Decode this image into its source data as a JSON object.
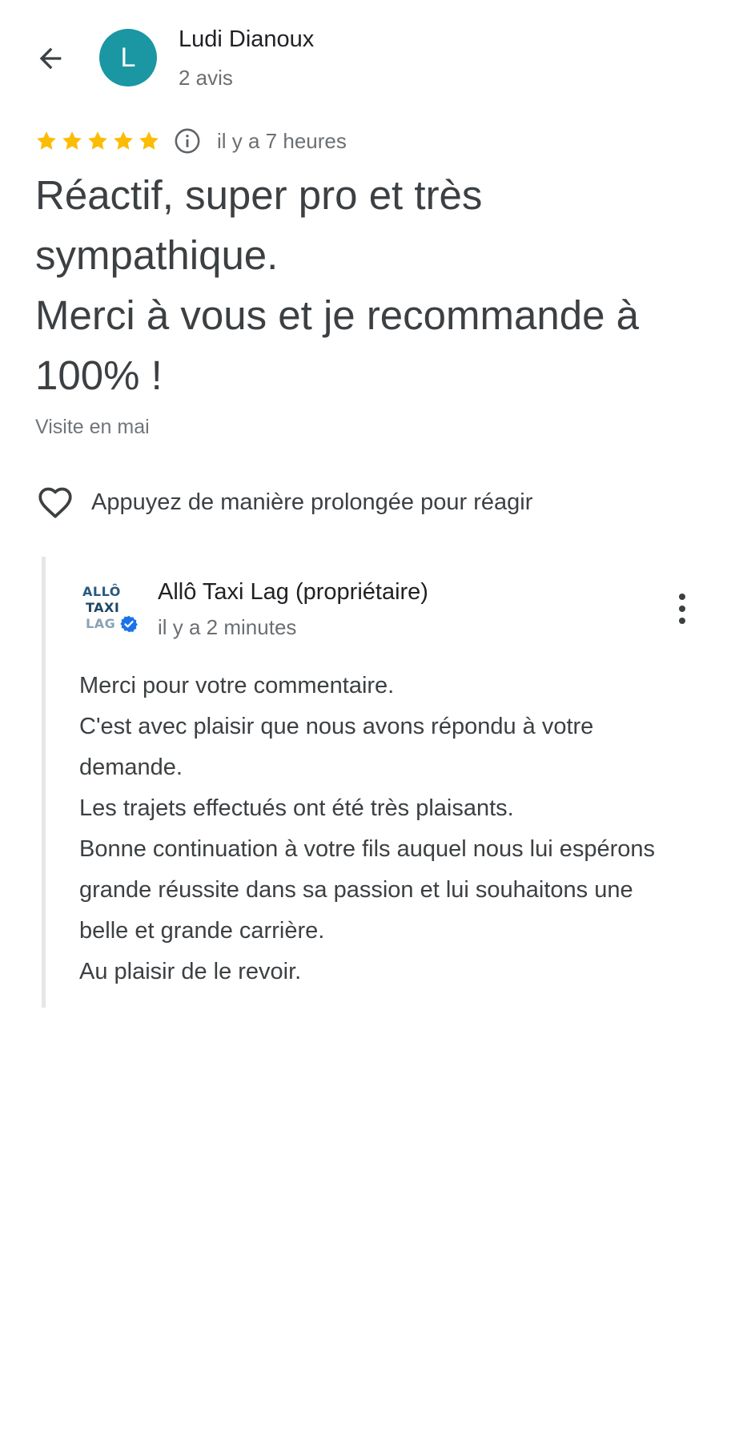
{
  "header": {
    "avatar_letter": "L",
    "avatar_color": "#1a97a3",
    "user_name": "Ludi Dianoux",
    "user_reviews": "2 avis"
  },
  "review": {
    "rating": 5,
    "rating_max": 5,
    "star_color": "#fbbc04",
    "time": "il y a 7 heures",
    "text": "Réactif, super pro et très sympathique.\nMerci à vous et je recommande à 100% !",
    "visit": "Visite en mai"
  },
  "reaction": {
    "label": "Appuyez de manière prolongée pour réagir"
  },
  "owner_reply": {
    "logo_text": [
      "ALLÔ",
      "TAXI",
      "LAG"
    ],
    "name": "Allô Taxi Lag (propriétaire)",
    "time": "il y a 2 minutes",
    "text": "Merci pour votre commentaire.\nC'est avec plaisir que nous avons répondu à votre demande.\nLes trajets effectués ont été très plaisants.\nBonne continuation à votre fils auquel nous lui espérons grande réussite dans sa passion et lui souhaitons une belle et grande carrière.\nAu plaisir de le revoir.",
    "verified_color": "#1a73e8"
  },
  "icons": {
    "back": "arrow-left-icon",
    "info": "info-circle-icon",
    "heart": "heart-outline-icon",
    "more": "more-vertical-icon",
    "verified": "verified-badge-icon"
  }
}
